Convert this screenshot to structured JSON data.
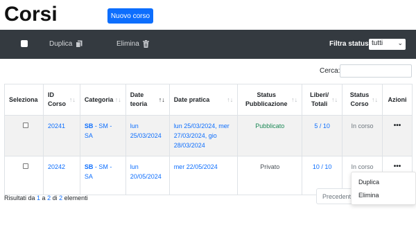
{
  "header": {
    "title": "Corsi",
    "new_course_label": "Nuovo corso"
  },
  "toolbar": {
    "duplicate_label": "Duplica",
    "delete_label": "Elimina",
    "filter_label": "Filtra status",
    "filter_value": "tutti"
  },
  "search": {
    "label": "Cerca:"
  },
  "table": {
    "headers": {
      "select": "Seleziona",
      "id": "ID Corso",
      "category": "Categoria",
      "theory": "Date teoria",
      "practice": "Date pratica",
      "pub_status": "Status Pubblicazione",
      "seats": "Liberi/ Totali",
      "course_status": "Status Corso",
      "actions": "Azioni"
    },
    "rows": [
      {
        "id": "20241",
        "cat_main": "SB",
        "cat_rest": " - SM - SA",
        "theory": "lun 25/03/2024",
        "practice": "lun 25/03/2024, mer 27/03/2024, gio 28/03/2024",
        "pub_status": "Pubblicato",
        "seats": "5 / 10",
        "course_status": "In corso",
        "actions": "•••"
      },
      {
        "id": "20242",
        "cat_main": "SB",
        "cat_rest": " - SM - SA",
        "theory": "lun 20/05/2024",
        "practice": "mer 22/05/2024",
        "pub_status": "Privato",
        "seats": "10 / 10",
        "course_status": "In corso",
        "actions": "•••"
      }
    ]
  },
  "footer": {
    "results_prefix": "Risultati da ",
    "from": "1",
    "mid1": " a ",
    "to": "2",
    "mid2": " di ",
    "total": "2",
    "suffix": " elementi",
    "prev_label": "Precedente"
  },
  "action_menu": {
    "duplicate": "Duplica",
    "delete": "Elimina"
  },
  "colors": {
    "primary": "#0d6efd",
    "toolbar_bg": "#343a40",
    "success": "#198754"
  }
}
